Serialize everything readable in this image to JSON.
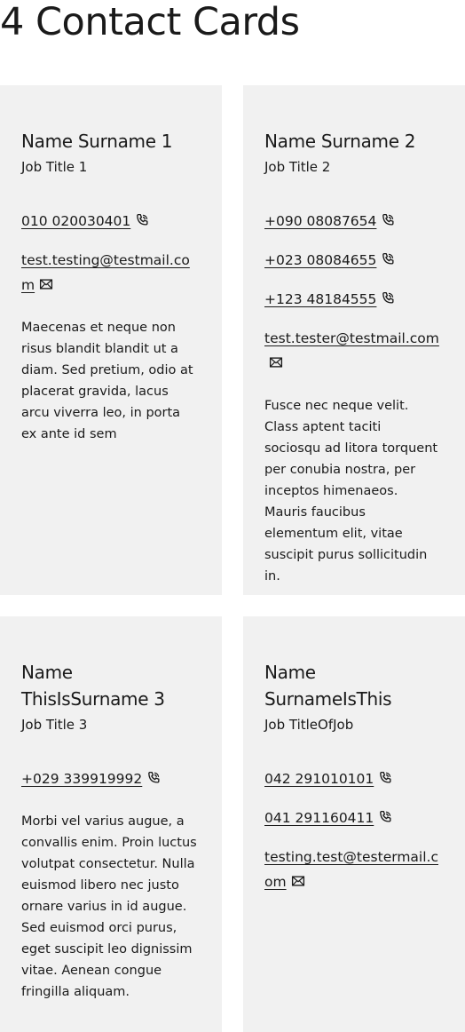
{
  "page": {
    "title": "4 Contact Cards"
  },
  "cards": [
    {
      "name": "Name Surname 1",
      "job": "Job Title 1",
      "phones": [
        "010 020030401"
      ],
      "emails": [
        "test.testing@testmail.com"
      ],
      "text": "Maecenas et neque non risus blandit blandit ut a diam. Sed pretium, odio at placerat gravida, lacus arcu viverra leo, in porta ex ante id sem"
    },
    {
      "name": "Name Surname 2",
      "job": "Job Title 2",
      "phones": [
        "+090 08087654",
        "+023 08084655",
        "+123 48184555"
      ],
      "emails": [
        "test.tester@testmail.com"
      ],
      "text": "Fusce nec neque velit. Class aptent taciti sociosqu ad litora torquent per conubia nostra, per inceptos himenaeos. Mauris faucibus elementum elit, vitae suscipit purus sollicitudin in."
    },
    {
      "name": "Name ThisIsSurname 3",
      "job": "Job Title 3",
      "phones": [
        "+029 339919992"
      ],
      "emails": [],
      "text": "Morbi vel varius augue, a convallis enim. Proin luctus volutpat consectetur. Nulla euismod libero nec justo ornare varius in id augue. Sed euismod orci purus, eget suscipit leo dignissim vitae. Aenean congue fringilla aliquam."
    },
    {
      "name": "Name SurnameIsThis",
      "job": "Job TitleOfJob",
      "phones": [
        "042 291010101",
        "041 291160411"
      ],
      "emails": [
        "testing.test@testermail.com"
      ],
      "text": ""
    }
  ],
  "icons": {
    "phone": "phone-icon",
    "email": "envelope-icon"
  },
  "colors": {
    "card_background": "#f1f1f1",
    "text": "#1a1a1a",
    "page_background": "#ffffff"
  }
}
